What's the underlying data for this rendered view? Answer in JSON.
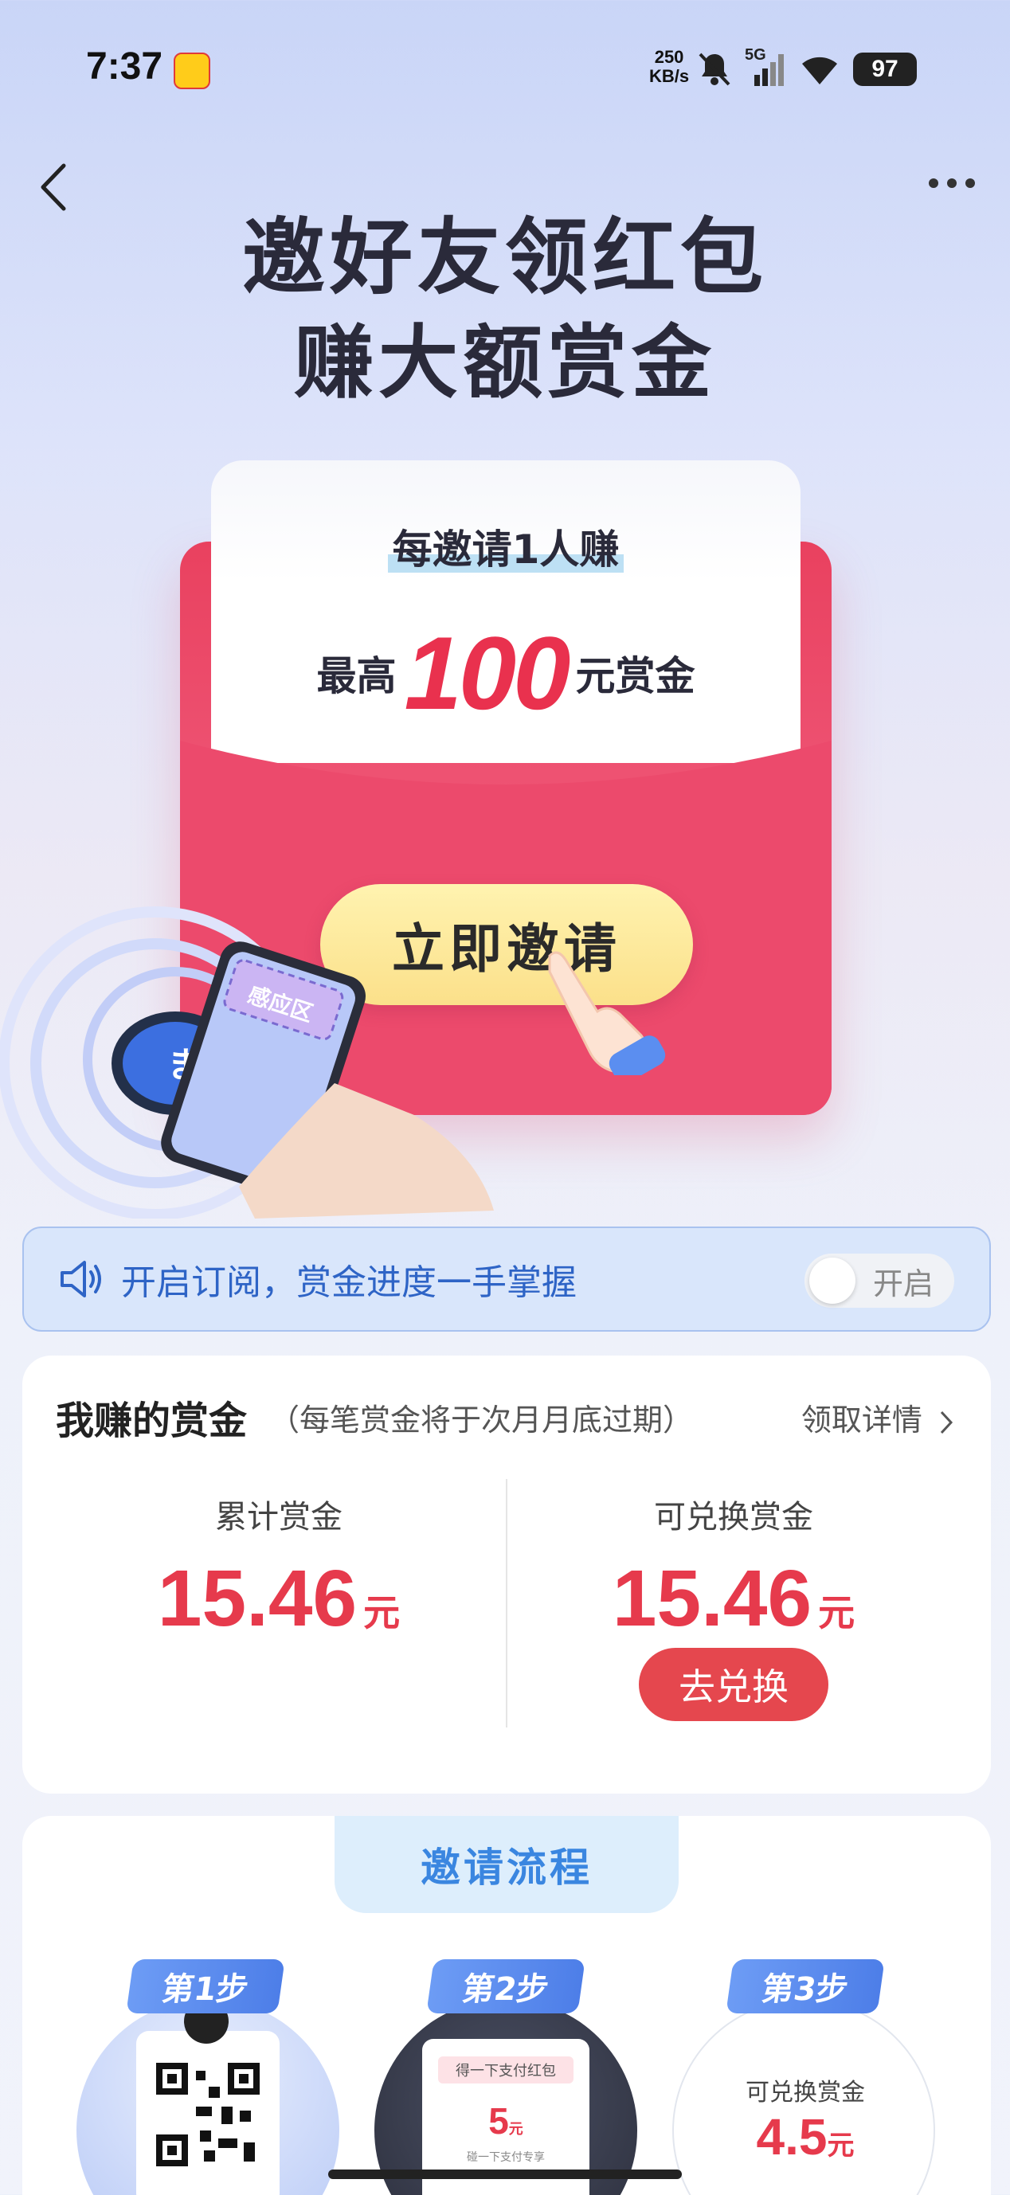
{
  "status_bar": {
    "time": "7:37",
    "net_speed_value": "250",
    "net_speed_unit": "KB/s",
    "signal_label": "5G",
    "battery": "97",
    "icons": [
      "app-notification-icon",
      "mute-bell-icon",
      "signal-icon",
      "wifi-icon",
      "battery-icon"
    ]
  },
  "nav": {
    "back_icon": "chevron-left-icon",
    "more_icon": "more-dots-icon"
  },
  "headline": {
    "line1": "邀好友领红包",
    "line2": "赚大额赏金"
  },
  "envelope_card": {
    "subtitle": "每邀请1人赚",
    "prefix": "最高",
    "amount": "100",
    "suffix": "元赏金",
    "button_label": "立即邀请",
    "illustration_label": "感应区",
    "colors": {
      "envelope": "#e9415f",
      "amount": "#e9314e",
      "button": "#fbe08a"
    }
  },
  "subscribe": {
    "icon": "speaker-icon",
    "text": "开启订阅，赏金进度一手掌握",
    "toggle_label": "开启",
    "toggle_on": false
  },
  "earnings": {
    "title": "我赚的赏金",
    "note": "（每笔赏金将于次月月底过期）",
    "detail_link": "领取详情",
    "cumulative": {
      "label": "累计赏金",
      "value": "15.46",
      "unit": "元"
    },
    "redeemable": {
      "label": "可兑换赏金",
      "value": "15.46",
      "unit": "元"
    },
    "redeem_button": "去兑换",
    "accent_color": "#e63a4c"
  },
  "process": {
    "title": "邀请流程",
    "steps": [
      {
        "tag": "第1步"
      },
      {
        "tag": "第2步",
        "inner_title": "得一下支付红包",
        "inner_value": "5",
        "inner_unit": "元",
        "inner_caption": "碰一下支付专享"
      },
      {
        "tag": "第3步",
        "inner_title": "可兑换赏金",
        "inner_value": "4.5",
        "inner_unit": "元"
      }
    ]
  }
}
